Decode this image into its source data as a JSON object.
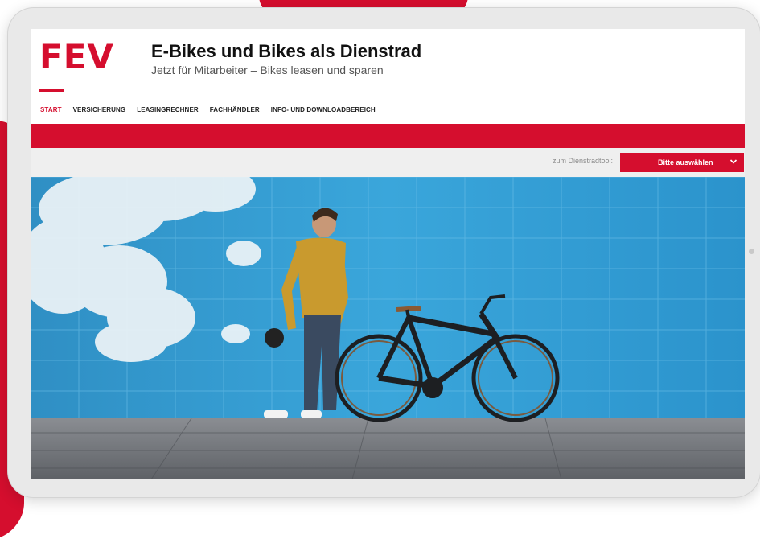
{
  "brand": {
    "logo_text": "FEV",
    "accent_color": "#d50e2e"
  },
  "header": {
    "title": "E-Bikes und Bikes als Dienstrad",
    "subtitle": "Jetzt für Mitarbeiter – Bikes leasen und sparen"
  },
  "nav": {
    "items": [
      {
        "label": "START",
        "active": true
      },
      {
        "label": "VERSICHERUNG",
        "active": false
      },
      {
        "label": "LEASINGRECHNER",
        "active": false
      },
      {
        "label": "FACHHÄNDLER",
        "active": false
      },
      {
        "label": "INFO- UND DOWNLOADBEREICH",
        "active": false
      }
    ]
  },
  "tool": {
    "label": "zum Dienstradtool:",
    "select_value": "Bitte auswählen",
    "chevron_icon": "chevron-down-icon"
  },
  "hero": {
    "image": "man-with-e-bike-photo",
    "description_icon": "photo"
  }
}
